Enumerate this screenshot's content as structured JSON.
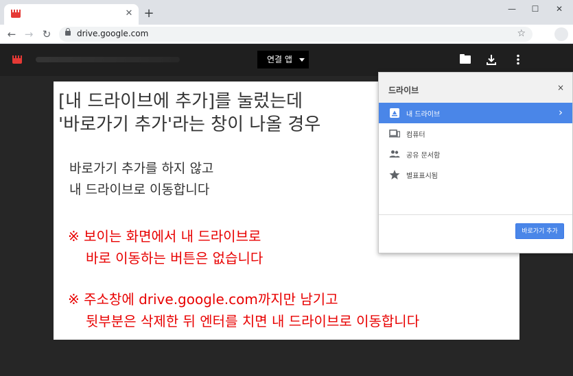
{
  "browser": {
    "tab_close": "✕",
    "new_tab": "+",
    "window_buttons": {
      "minimize": "—",
      "maximize": "☐",
      "close": "✕"
    },
    "nav": {
      "back": "←",
      "forward": "→",
      "reload": "↻"
    },
    "url": "drive.google.com",
    "star": "☆"
  },
  "viewer": {
    "open_with_label": "연결 앱",
    "icons": [
      "folder-icon",
      "download-icon",
      "more-vert-icon"
    ]
  },
  "slide": {
    "title_lines": [
      "[내 드라이브에 추가]를 눌렀는데",
      "'바로가기 추가'라는 창이 나올 경우"
    ],
    "body_lines": [
      "바로가기 추가를 하지 않고",
      "내 드라이브로 이동합니다"
    ],
    "note1_lines": [
      "※ 보이는 화면에서 내 드라이브로",
      "바로 이동하는 버튼은 없습니다"
    ],
    "note2_lines": [
      "※ 주소창에 drive.google.com까지만 남기고",
      "뒷부분은 삭제한 뒤 엔터를 치면 내 드라이브로 이동합니다"
    ]
  },
  "panel": {
    "title": "드라이브",
    "close": "×",
    "items": [
      {
        "label": "내 드라이브",
        "icon": "drive-icon",
        "selected": true
      },
      {
        "label": "컴퓨터",
        "icon": "computer-icon",
        "selected": false
      },
      {
        "label": "공유 문서함",
        "icon": "people-icon",
        "selected": false
      },
      {
        "label": "별표표시됨",
        "icon": "star-icon",
        "selected": false
      }
    ],
    "chevron": "›",
    "add_shortcut_label": "바로가기 추가"
  },
  "colors": {
    "accent": "#4a86e8",
    "note_red": "#e80000"
  }
}
